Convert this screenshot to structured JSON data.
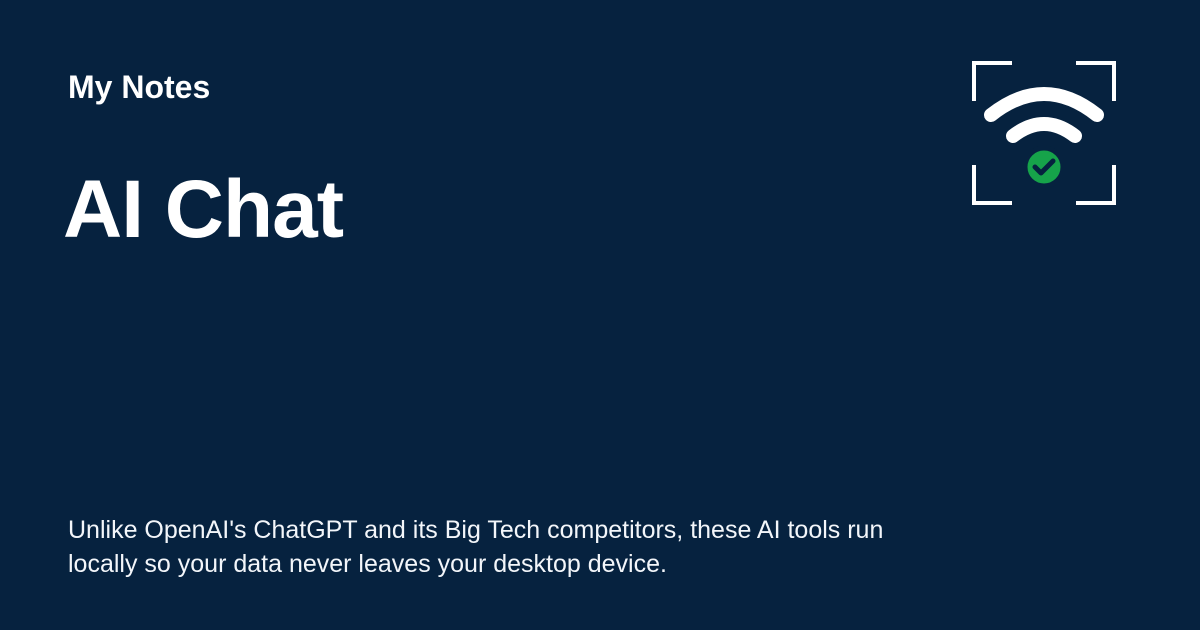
{
  "card": {
    "site_name": "My Notes",
    "title": "AI Chat",
    "description": "Unlike OpenAI's ChatGPT and its Big Tech competitors, these AI tools run locally so your data never leaves your desktop device.",
    "logo_icon": "wifi-check-icon"
  },
  "colors": {
    "background": "#06223f",
    "text": "#ffffff",
    "accent": "#16a34a"
  }
}
